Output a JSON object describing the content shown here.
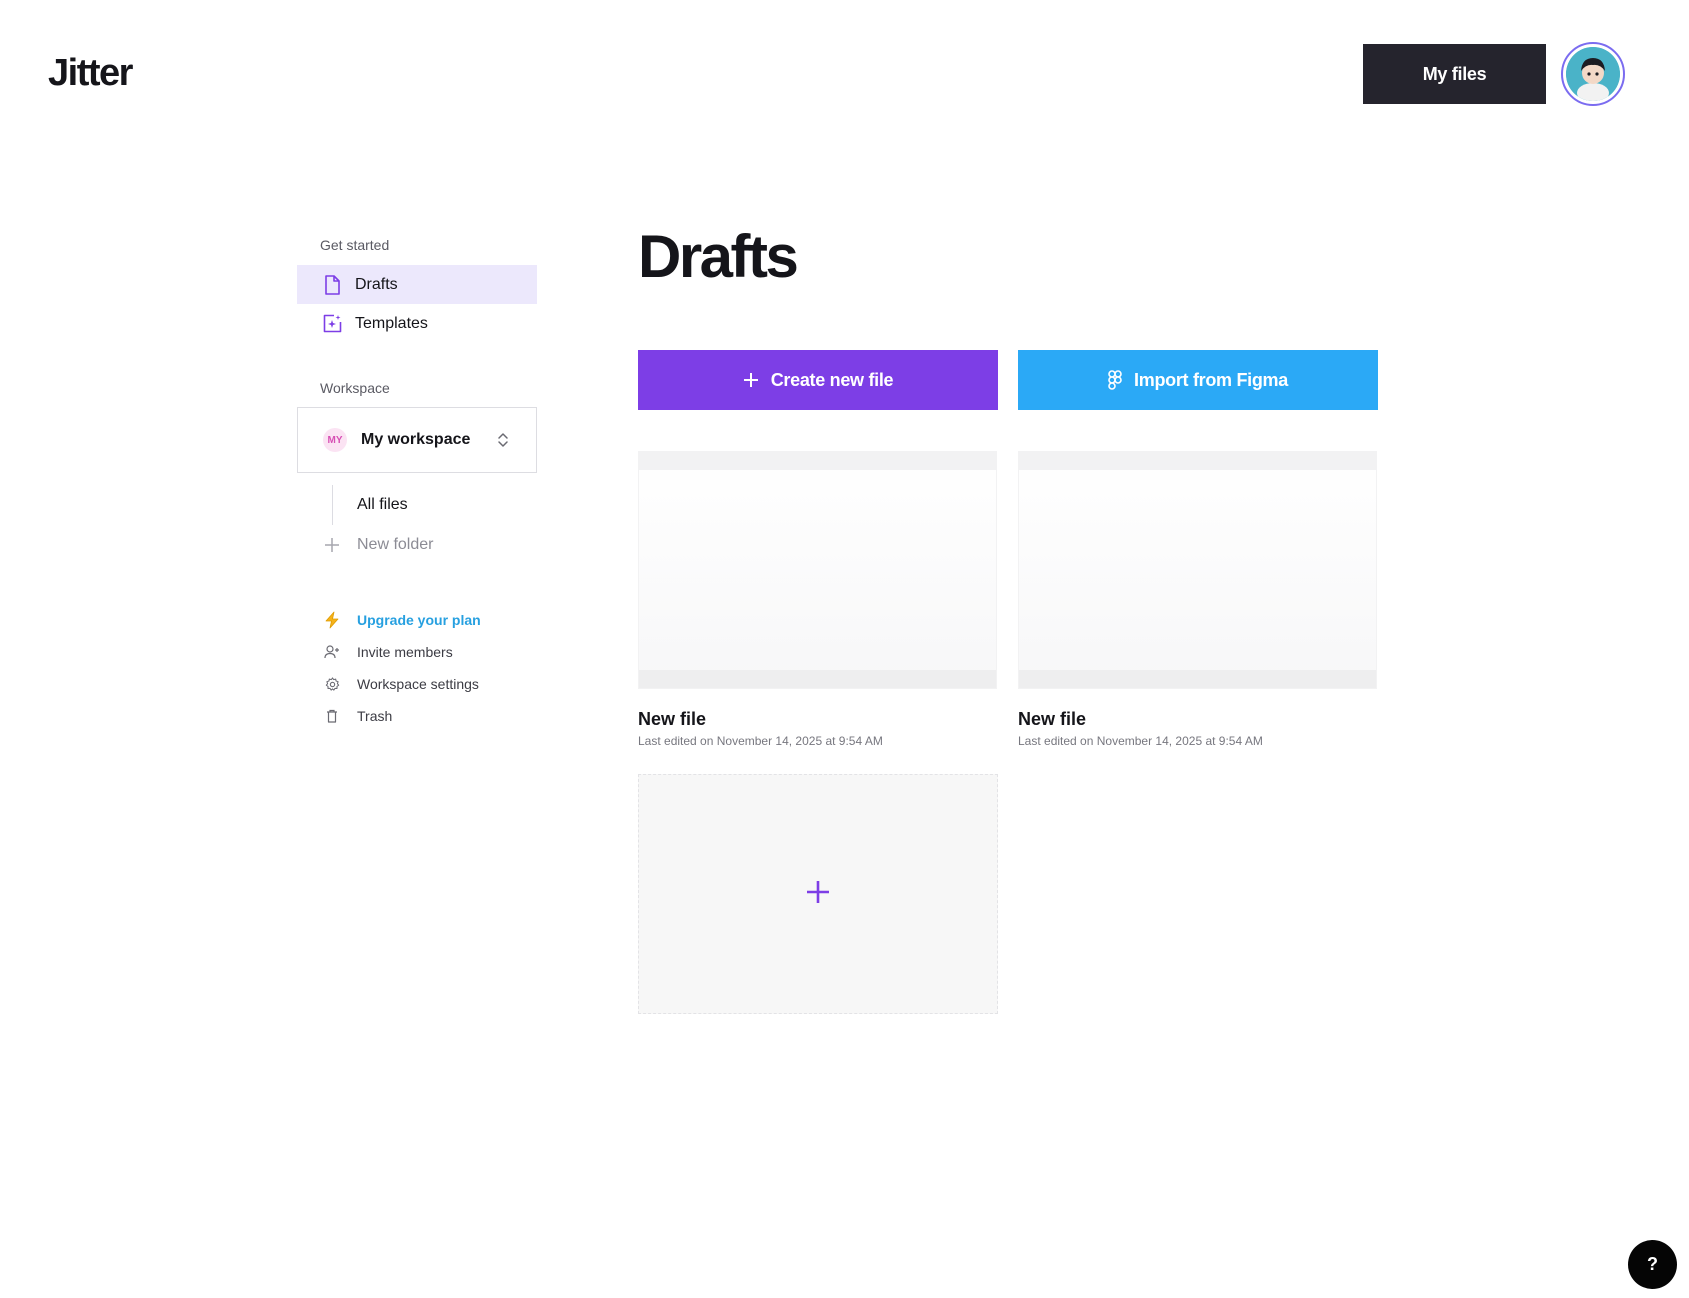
{
  "header": {
    "logo": "Jitter",
    "my_files_label": "My files"
  },
  "sidebar": {
    "get_started_label": "Get started",
    "nav": [
      {
        "label": "Drafts",
        "icon": "file-icon",
        "active": true
      },
      {
        "label": "Templates",
        "icon": "template-icon",
        "active": false
      }
    ],
    "workspace_label": "Workspace",
    "workspace": {
      "badge": "MY",
      "name": "My workspace",
      "badge_bg": "#fbe3f3",
      "badge_color": "#d74fb4"
    },
    "all_files_label": "All files",
    "new_folder_label": "New folder",
    "links": {
      "upgrade": "Upgrade your plan",
      "invite": "Invite members",
      "settings": "Workspace settings",
      "trash": "Trash"
    }
  },
  "main": {
    "title": "Drafts",
    "create_label": "Create new file",
    "import_label": "Import from Figma",
    "files": [
      {
        "name": "New file",
        "edited": "Last edited on November 14, 2025 at 9:54 AM"
      },
      {
        "name": "New file",
        "edited": "Last edited on November 14, 2025 at 9:54 AM"
      }
    ]
  },
  "help": {
    "label": "?"
  },
  "colors": {
    "accent_purple": "#7d3ee6",
    "accent_blue": "#2ba9f6",
    "dark_button": "#25242d",
    "active_nav_bg": "#ece8fc",
    "upgrade_link": "#27a0e0"
  }
}
